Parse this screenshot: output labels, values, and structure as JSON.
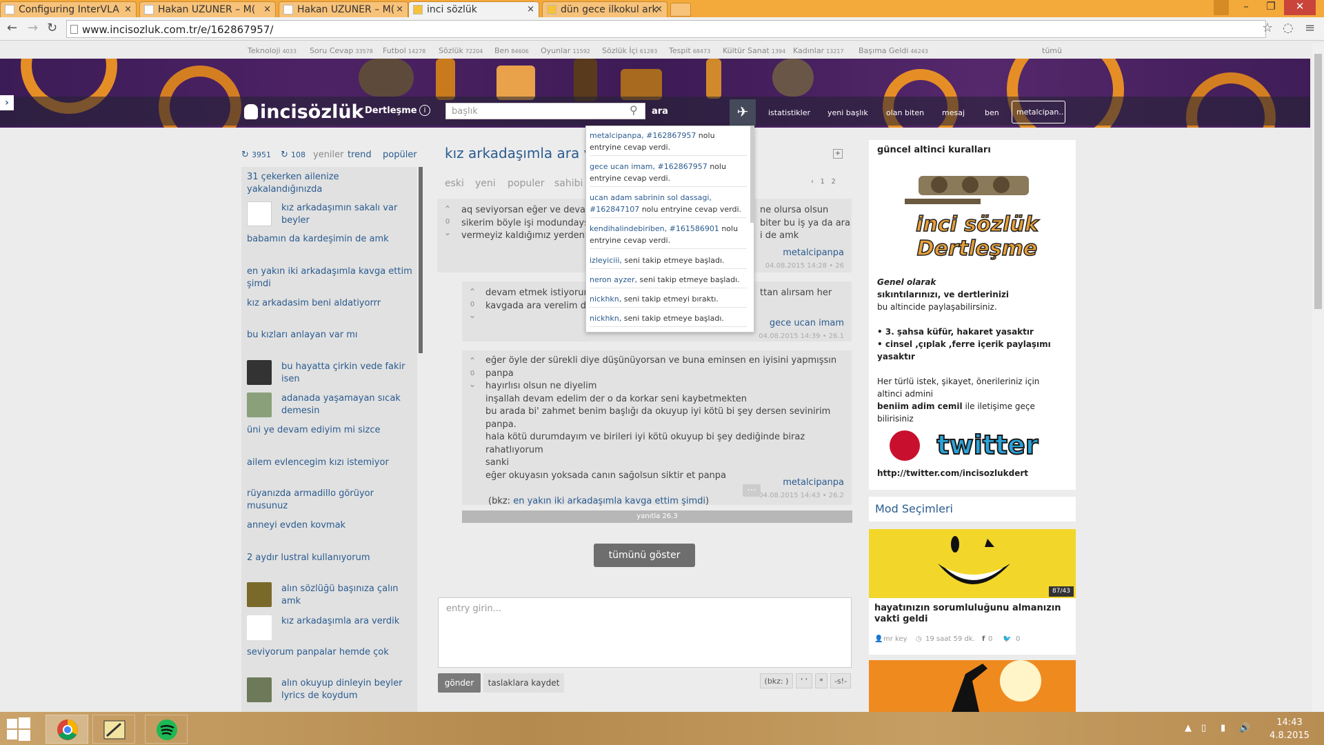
{
  "browser": {
    "tabs": [
      {
        "label": "Configuring InterVLA"
      },
      {
        "label": "Hakan UZUNER – M("
      },
      {
        "label": "Hakan UZUNER – M("
      },
      {
        "label": "inci sözlük"
      },
      {
        "label": "dün gece ilkokul ark"
      }
    ],
    "url": "www.incisozluk.com.tr/e/162867957/"
  },
  "categories": [
    {
      "name": "Teknoloji",
      "count": "4033"
    },
    {
      "name": "Soru Cevap",
      "count": "33578"
    },
    {
      "name": "Futbol",
      "count": "14278"
    },
    {
      "name": "Sözlük",
      "count": "72204"
    },
    {
      "name": "Ben",
      "count": "84606"
    },
    {
      "name": "Oyunlar",
      "count": "11592"
    },
    {
      "name": "Sözlük İçi",
      "count": "61283"
    },
    {
      "name": "Tespit",
      "count": "68473"
    },
    {
      "name": "Kültür Sanat",
      "count": "1394"
    },
    {
      "name": "Kadınlar",
      "count": "13217"
    },
    {
      "name": "Başıma Geldi",
      "count": "46243"
    }
  ],
  "all_label": "tümü",
  "header": {
    "logo": "incisözlük",
    "channel": "Dertleşme",
    "search_placeholder": "başlık",
    "search_button": "ara",
    "nav": [
      "istatistikler",
      "yeni başlık",
      "olan biten",
      "mesaj",
      "ben"
    ],
    "user": "metalcipan.."
  },
  "left": {
    "count1": "3951",
    "count2": "108",
    "tabs": [
      "yeniler",
      "trend",
      "popüler"
    ],
    "items": [
      "31 çekerken ailenize yakalandığınızda",
      "kız arkadaşımın sakalı var beyler",
      "babamın da kardeşimin de amk",
      "en yakın iki arkadaşımla kavga ettim şimdi",
      "kız arkadasim beni aldatiyorrr",
      "bu kızları anlayan var mı",
      "bu hayatta çirkin vede fakir isen",
      "adanada yaşamayan sıcak demesin",
      "üni ye devam ediyim mi sizce",
      "ailem evlencegim kızı istemiyor",
      "rüyanızda armadillo görüyor musunuz",
      "anneyi evden kovmak",
      "2 aydır lustral kullanıyorum",
      "alın sözlüğü başınıza çalın amk",
      "kız arkadaşımla ara verdik",
      "seviyorum panpalar hemde çok",
      "alın okuyup dinleyin beyler lyrics de koydum"
    ]
  },
  "topic": {
    "title": "kız arkadaşımla ara ve",
    "tabs": [
      "eski",
      "yeni",
      "populer",
      "sahibi"
    ],
    "pages": [
      "1",
      "2"
    ],
    "entries": [
      {
        "votes": "0",
        "lines": [
          "aq seviyorsan eğer ve devam",
          "sikerim böyle işi modundaysa",
          "vermeyiz kaldığımız yerden de"
        ],
        "tail": [
          "ne olursa olsun",
          "biter bu iş ya da ara",
          "i de amk"
        ],
        "author": "metalcipanpa",
        "date": "04.08.2015 14:28 • 26"
      },
      {
        "votes": "0",
        "lines": [
          "devam etmek istiyorum",
          "kavgada ara verelim diy"
        ],
        "tail": [
          "ttan alırsam her"
        ],
        "author": "gece ucan imam",
        "date": "04.08.2015 14:39 • 26.1"
      },
      {
        "votes": "0",
        "lines": [
          "eğer öyle der sürekli diye düşünüyorsan ve buna eminsen en iyisini yapmışsın panpa",
          "hayırlısı olsun ne diyelim",
          "inşallah devam edelim der o da korkar seni kaybetmekten",
          "bu arada bi' zahmet benim başlığı da okuyup iyi kötü bi şey dersen sevinirim panpa.",
          "hala kötü durumdayım ve birileri iyi kötü okuyup bi şey dediğinde biraz rahatlıyorum",
          "sanki",
          "eğer okuyasın yoksada canın sağolsun siktir et panpa"
        ],
        "bkz_prefix": "(bkz:",
        "bkz_link": "en yakın iki arkadaşımla kavga ettim şimdi",
        "bkz_suffix": ")",
        "author": "metalcipanpa",
        "date": "04.08.2015 14:43 • 26.2"
      }
    ],
    "reply_bar": "yanıtla 26.3",
    "show_all": "tümünü göster",
    "editor_placeholder": "entry girin...",
    "submit": "gönder",
    "draft": "taslaklara kaydet",
    "format_buttons": [
      "(bkz: )",
      "' '",
      "*",
      "-s!-"
    ]
  },
  "notifications": [
    {
      "user": "metalcipanpa, #162867957",
      "text": " nolu entryine cevap verdi."
    },
    {
      "user": "gece ucan imam, #162867957",
      "text": " nolu entryine cevap verdi."
    },
    {
      "user": "ucan adam sabrinin sol dassagi, #162847107",
      "text": " nolu entryine cevap verdi."
    },
    {
      "user": "kendihalindebiriben, #161586901",
      "text": " nolu entryine cevap verdi."
    },
    {
      "user": "izleyiciii,",
      "text": " seni takip etmeye başladı."
    },
    {
      "user": "neron ayzer,",
      "text": " seni takip etmeye başladı."
    },
    {
      "user": "nickhkn,",
      "text": " seni takip etmeyi bıraktı."
    },
    {
      "user": "nickhkn,",
      "text": " seni takip etmeye başladı."
    }
  ],
  "rules": {
    "title": "güncel altinci kuralları",
    "logo_line1": "inci sözlük",
    "logo_line2": "Dertleşme",
    "general": "Genel olarak",
    "l1": "sıkıntılarınızı, ve dertlerinizi",
    "l2": "bu altincide paylaşabilirsiniz.",
    "r1": "• 3. şahsa küfür, hakaret yasaktır",
    "r2": "• cinsel ,çıplak ,ferre içerik paylaşımı",
    "r3": "yasaktır",
    "c1": "Her türlü istek, şikayet, önerileriniz için",
    "c2": "altinci admini",
    "c3b": "beniim adim cemil",
    "c3": " ile iletişime geçe",
    "c4": "bilirisiniz",
    "twitter_logo": "twitter",
    "twitter_url": "http://twitter.com/incisozlukdert"
  },
  "mod": {
    "title": "Mod Seçimleri",
    "score": "87/43",
    "card_title": "hayatınızın sorumluluğunu almanızın vakti geldi",
    "author": "mr key",
    "time": "19 saat 59 dk.",
    "fb": "0",
    "tw": "0"
  },
  "taskbar": {
    "time": "14:43",
    "date": "4.8.2015"
  },
  "colors": {
    "accent": "#2a5b8f",
    "banner": "#4d2265",
    "orange": "#e68e26"
  }
}
